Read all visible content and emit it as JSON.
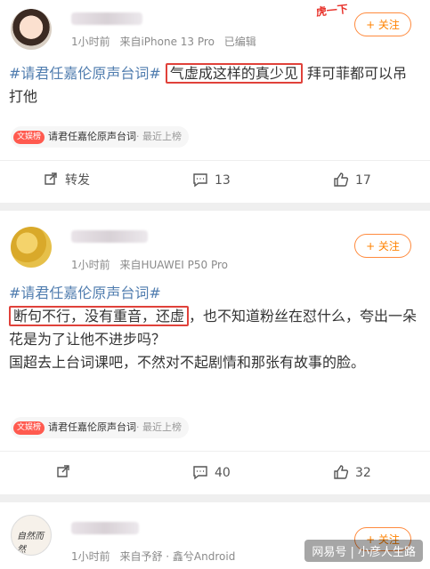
{
  "posts": [
    {
      "username": "",
      "time": "1小时前",
      "source": "来自iPhone 13 Pro",
      "edited": "已编辑",
      "follow_label": "+ 关注",
      "sticker": "虎一下",
      "hashtag": "#请君任嘉伦原声台词#",
      "highlighted": "气虚成这样的真少见",
      "text_after": " 拜可菲都可以吊打他",
      "chip_badge": "文娱榜",
      "chip_text": "请君任嘉伦原声台词",
      "chip_suffix": "· 最近上榜",
      "actions": {
        "repost": "转发",
        "comments": "13",
        "likes": "17"
      }
    },
    {
      "username": "",
      "time": "1小时前",
      "source": "来自HUAWEI P50 Pro",
      "follow_label": "+ 关注",
      "hashtag": "#请君任嘉伦原声台词#",
      "highlighted": "断句不行，没有重音，还虚",
      "text_after": "，也不知道粉丝在怼什么，夸出一朵花是为了让他不进步吗？",
      "text_line3": "国超去上台词课吧，不然对不起剧情和那张有故事的脸。",
      "chip_badge": "文娱榜",
      "chip_text": "请君任嘉伦原声台词",
      "chip_suffix": "· 最近上榜",
      "actions": {
        "repost": "",
        "comments": "40",
        "likes": "32"
      }
    },
    {
      "username": "",
      "avatar_text": "自然而然",
      "time": "1小时前",
      "source": "来自予舒 · 鑫兮Android",
      "follow_label": "+ 关注"
    }
  ],
  "watermark": "网易号 | 小彦人生路",
  "colors": {
    "accent": "#ff8200",
    "hashtag": "#507daf",
    "highlight_border": "#e0413a"
  },
  "icons": [
    "repost-icon",
    "comment-icon",
    "like-icon"
  ]
}
